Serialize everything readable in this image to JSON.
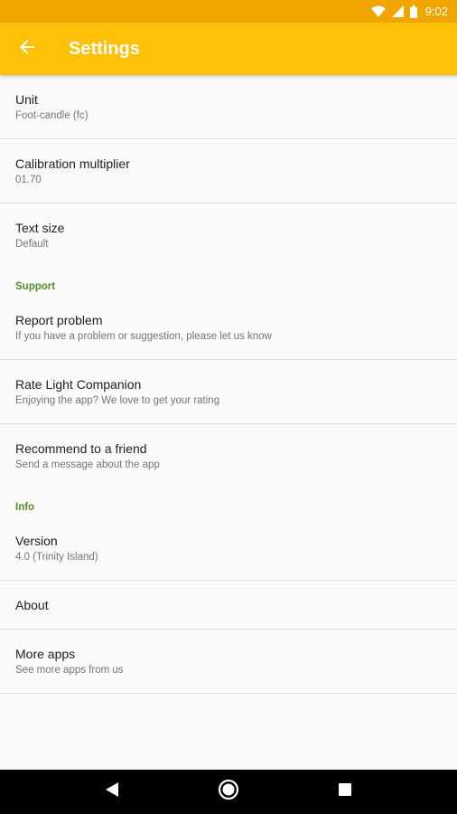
{
  "status_bar": {
    "time": "9:02",
    "icons": [
      "wifi-icon",
      "cell-signal-icon",
      "battery-icon"
    ]
  },
  "app_bar": {
    "title": "Settings",
    "back_icon": "arrow-back-icon"
  },
  "colors": {
    "status_bar": "#f0a500",
    "app_bar": "#ffc107",
    "category_label": "#558b2f",
    "background": "#fafafa"
  },
  "preferences": {
    "unit": {
      "title": "Unit",
      "summary": "Foot-candle (fc)"
    },
    "calibration": {
      "title": "Calibration multiplier",
      "summary": "01.70"
    },
    "text_size": {
      "title": "Text size",
      "summary": "Default"
    }
  },
  "support": {
    "category": "Support",
    "report": {
      "title": "Report problem",
      "summary": "If you have a problem or suggestion, please let us know"
    },
    "rate": {
      "title": "Rate Light Companion",
      "summary": "Enjoying the app? We love to get your rating"
    },
    "recommend": {
      "title": "Recommend to a friend",
      "summary": "Send a message about the app"
    }
  },
  "info": {
    "category": "Info",
    "version": {
      "title": "Version",
      "summary": "4.0 (Trinity Island)"
    },
    "about": {
      "title": "About"
    },
    "more_apps": {
      "title": "More apps",
      "summary": "See more apps from us"
    }
  },
  "nav_bar": {
    "icons": [
      "back-triangle-icon",
      "home-circle-icon",
      "recents-square-icon"
    ]
  }
}
